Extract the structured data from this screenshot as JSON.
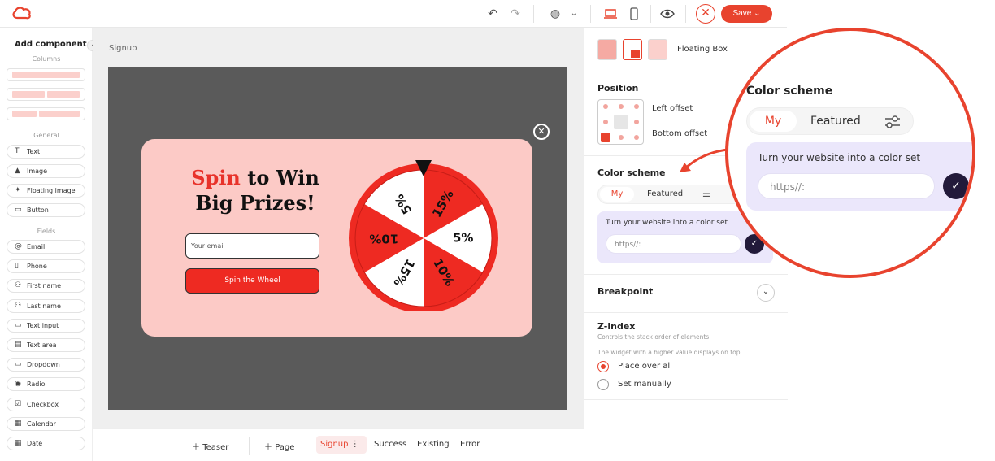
{
  "topbar": {
    "save_label": "Save"
  },
  "sidebar": {
    "title": "Add component",
    "columns_label": "Columns",
    "general_label": "General",
    "general": [
      {
        "label": "Text",
        "icon": "T"
      },
      {
        "label": "Image",
        "icon": "▲"
      },
      {
        "label": "Floating image",
        "icon": "✦"
      },
      {
        "label": "Button",
        "icon": "▭"
      }
    ],
    "fields_label": "Fields",
    "fields": [
      {
        "label": "Email",
        "icon": "@"
      },
      {
        "label": "Phone",
        "icon": "▯"
      },
      {
        "label": "First name",
        "icon": "⚇"
      },
      {
        "label": "Last name",
        "icon": "⚇"
      },
      {
        "label": "Text input",
        "icon": "▭"
      },
      {
        "label": "Text area",
        "icon": "▤"
      },
      {
        "label": "Dropdown",
        "icon": "▭"
      },
      {
        "label": "Radio",
        "icon": "◉"
      },
      {
        "label": "Checkbox",
        "icon": "☑"
      },
      {
        "label": "Calendar",
        "icon": "▦"
      },
      {
        "label": "Date",
        "icon": "▦"
      }
    ]
  },
  "canvas": {
    "breadcrumb": "Signup",
    "popup": {
      "headline_red": "Spin",
      "headline_rest1": " to Win",
      "headline_rest2": "Big Prizes!",
      "email_placeholder": "Your email",
      "button_label": "Spin the Wheel",
      "wheel_labels": [
        "15%",
        "5%",
        "10%",
        "15%",
        "10%",
        "5%"
      ]
    }
  },
  "bottombar": {
    "teaser": "Teaser",
    "page": "Page",
    "signup": "Signup",
    "success": "Success",
    "existing": "Existing",
    "error": "Error"
  },
  "panel": {
    "layout_label": "Floating Box",
    "position_label": "Position",
    "left_offset": "Left offset",
    "bottom_offset": "Bottom offset",
    "color_scheme_label": "Color scheme",
    "tab_my": "My",
    "tab_featured": "Featured",
    "cs_prompt": "Turn your website into a color set",
    "url_placeholder": "https//:",
    "breakpoint_label": "Breakpoint",
    "zindex_label": "Z-index",
    "zindex_desc1": "Controls the stack order of elements.",
    "zindex_desc2": "The widget with a higher value displays on top.",
    "opt_over_all": "Place over all",
    "opt_manual": "Set manually"
  },
  "zoom": {
    "title": "Color scheme",
    "tab_my": "My",
    "tab_featured": "Featured",
    "prompt": "Turn your website into a color set",
    "url_placeholder": "https//:"
  },
  "colors": {
    "accent": "#e8432e",
    "popup_bg": "#fccac6",
    "wheel_red": "#ee2a22",
    "cs_bg": "#ebe7fb",
    "check_bg": "#221a3a"
  }
}
